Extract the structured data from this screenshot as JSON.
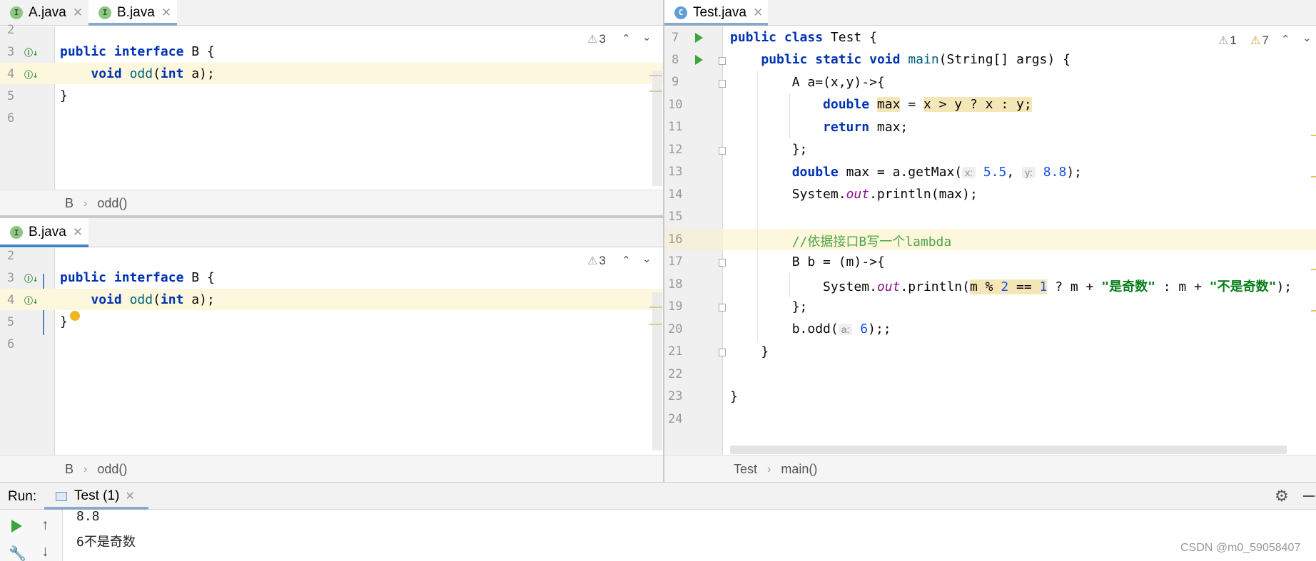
{
  "left_top": {
    "tabs": [
      {
        "label": "A.java",
        "icon": "interface-icon",
        "icon_letter": "I"
      },
      {
        "label": "B.java",
        "icon": "interface-icon",
        "icon_letter": "I"
      }
    ],
    "warnings": "3",
    "line_numbers": [
      "2",
      "3",
      "4",
      "5",
      "6"
    ],
    "breadcrumb": [
      "B",
      "odd()"
    ]
  },
  "left_bottom": {
    "tabs": [
      {
        "label": "B.java",
        "icon": "interface-icon",
        "icon_letter": "I"
      }
    ],
    "warnings": "3",
    "line_numbers": [
      "2",
      "3",
      "4",
      "5",
      "6"
    ],
    "breadcrumb": [
      "B",
      "odd()"
    ]
  },
  "right": {
    "tabs": [
      {
        "label": "Test.java",
        "icon": "class-icon",
        "icon_letter": "C"
      }
    ],
    "weak_warnings": "1",
    "warnings": "7",
    "line_numbers": [
      "7",
      "8",
      "9",
      "10",
      "11",
      "12",
      "13",
      "14",
      "15",
      "16",
      "17",
      "18",
      "19",
      "20",
      "21",
      "22",
      "23",
      "24"
    ],
    "breadcrumb": [
      "Test",
      "main()"
    ]
  },
  "code": {
    "iface_public": "public",
    "iface_interface": "interface",
    "iface_name": "B",
    "iface_brace": "{",
    "void": "void",
    "odd": "odd",
    "int": "int",
    "param_a": "a",
    "close": "}",
    "l7_public": "public",
    "l7_class": "class",
    "l7_name": "Test",
    "l8_public": "public",
    "l8_static": "static",
    "l8_void": "void",
    "l8_main": "main",
    "l8_args": "(String[] args) {",
    "l9": "A a=(x,y)->{",
    "l10_double": "double",
    "l10_max": "max",
    "l10_eq": " = ",
    "l10_expr": "x > y ? x : y",
    "l10_semi": ";",
    "l11_return": "return",
    "l11_rest": " max;",
    "l12": "};",
    "l13_double": "double",
    "l13_mid": " max = a.getMax(",
    "l13_hint_x": "x:",
    "l13_v1": "5.5",
    "l13_comma": ", ",
    "l13_hint_y": "y:",
    "l13_v2": "8.8",
    "l13_end": ");",
    "l14_a": "System.",
    "l14_out": "out",
    "l14_b": ".println(max);",
    "l16": "//依据接口B写一个lambda",
    "l17": "B b = (m)->{",
    "l18_a": "System.",
    "l18_out": "out",
    "l18_b": ".println(",
    "l18_m": "m % ",
    "l18_2": "2",
    "l18_eq": " == ",
    "l18_1": "1",
    "l18_c": " ? m + ",
    "l18_s1": "\"是奇数\"",
    "l18_d": " : m + ",
    "l18_s2": "\"不是奇数\"",
    "l18_e": ");",
    "l19": "};",
    "l20_a": "b.odd(",
    "l20_hint": "a:",
    "l20_v": "6",
    "l20_b": ");;",
    "l21": "}",
    "l23": "}"
  },
  "run": {
    "label": "Run:",
    "tab": "Test (1)",
    "output": [
      "8.8",
      "6不是奇数"
    ]
  },
  "watermark": "CSDN @m0_59058407",
  "colors": {
    "accent": "#4083c9",
    "run_green": "#3ea43e",
    "warning": "#d6a12b"
  }
}
